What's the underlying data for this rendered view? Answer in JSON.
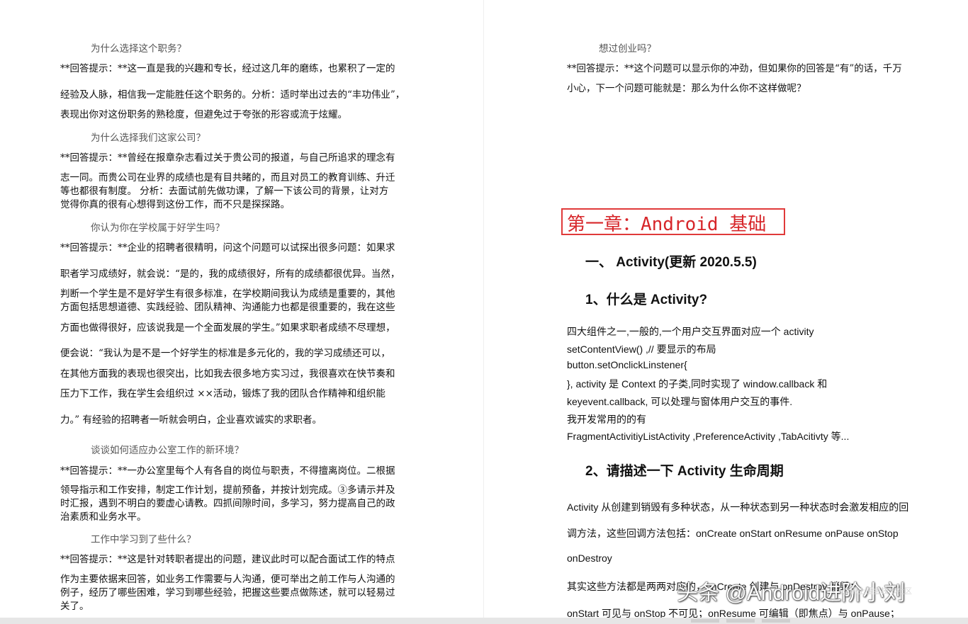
{
  "left": {
    "q1": "为什么选择这个职务？",
    "a1_l1": "**回答提示：**这一直是我的兴趣和专长，经过这几年的磨练，也累积了一定的",
    "a1_l2": "经验及人脉，相信我一定能胜任这个职务的。分析：适时举出过去的“丰功伟业”，",
    "a1_l3": "表现出你对这份职务的熟稔度，但避免过于夸张的形容或流于炫耀。",
    "q2": "为什么选择我们这家公司？",
    "a2_l1": "**回答提示：**曾经在报章杂志看过关于贵公司的报道，与自己所追求的理念有",
    "a2_l2": "志一同。而贵公司在业界的成绩也是有目共睹的，而且对员工的教育训练、升迁",
    "a2_l3": "等也都很有制度。 分析：去面试前先做功课，了解一下该公司的背景，让对方",
    "a2_l4": "觉得你真的很有心想得到这份工作，而不只是探探路。",
    "q3": "你认为你在学校属于好学生吗？",
    "a3_l1": "**回答提示：**企业的招聘者很精明，问这个问题可以试探出很多问题：如果求",
    "a3_l2": "职者学习成绩好，就会说：“是的，我的成绩很好，所有的成绩都很优异。当然，",
    "a3_l3": "判断一个学生是不是好学生有很多标准，在学校期间我认为成绩是重要的，其他",
    "a3_l4": "方面包括思想道德、实践经验、团队精神、沟通能力也都是很重要的，我在这些",
    "a3_l5": "方面也做得很好，应该说我是一个全面发展的学生。”如果求职者成绩不尽理想，",
    "a3_l6": "便会说：“我认为是不是一个好学生的标准是多元化的，我的学习成绩还可以，",
    "a3_l7": "在其他方面我的表现也很突出，比如我去很多地方实习过，我很喜欢在快节奏和",
    "a3_l8": "压力下工作，我在学生会组织过 ××活动，锻炼了我的团队合作精神和组织能",
    "a3_l9": "力。” 有经验的招聘者一听就会明白，企业喜欢诚实的求职者。",
    "q4": "谈谈如何适应办公室工作的新环境？",
    "a4_l1": "**回答提示：**一办公室里每个人有各自的岗位与职责，不得擅离岗位。二根据",
    "a4_l2": "领导指示和工作安排，制定工作计划，提前预备，并按计划完成。③多请示并及",
    "a4_l3": "时汇报，遇到不明白的要虚心请教。四抓间隙时间，多学习，努力提高自己的政",
    "a4_l4": "治素质和业务水平。",
    "q5": "工作中学习到了些什么？",
    "a5_l1": "**回答提示：**这是针对转职者提出的问题，建议此时可以配合面试工作的特点",
    "a5_l2": "作为主要依据来回答，如业务工作需要与人沟通，便可举出之前工作与人沟通的",
    "a5_l3": "例子，经历了哪些困难，学习到哪些经验，把握这些要点做陈述，就可以轻易过",
    "a5_l4": "关了。"
  },
  "right": {
    "q1": "想过创业吗？",
    "a1_l1": "**回答提示：**这个问题可以显示你的冲劲，但如果你的回答是“有”的话，千万",
    "a1_l2": "小心，下一个问题可能就是：那么为什么你不这样做呢？",
    "chapter": "第一章：Android 基础",
    "h1": "一、  Activity(更新 2020.5.5)",
    "h2": "1、什么是 Activity?",
    "b1": "四大组件之一,一般的,一个用户交互界面对应一个 activity",
    "b2": "setContentView() ,//  要显示的布局",
    "b3": "button.setOnclickLinstener{",
    "b4": "}, activity  是 Context 的子类,同时实现了 window.callback 和",
    "b5": "keyevent.callback, 可以处理与窗体用户交互的事件.",
    "b6": "我开发常用的的有",
    "b7": "FragmentActivitiyListActivity    ,PreferenceActivity ,TabAcitivty 等...",
    "h3": "2、请描述一下 Activity  生命周期",
    "c1": "Activity 从创建到销毁有多种状态，从一种状态到另一种状态时会激发相应的回",
    "c2": "调方法，这些回调方法包括：onCreate onStart onResume onPause onStop",
    "c3": "onDestroy",
    "c4": "其实这些方法都是两两对应的，onCreate 创建与 onDestroy 销毁；",
    "c5": "onStart 可见与 onStop 不可见；onResume 可编辑（即焦点）与 onPause；"
  },
  "watermark": {
    "main": "头条 @Android进阶小刘",
    "sub": "@稀土掘金技术社区"
  }
}
